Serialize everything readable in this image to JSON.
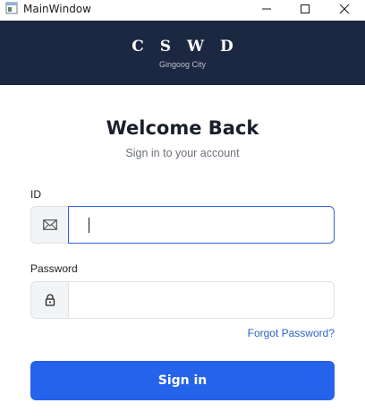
{
  "window": {
    "title": "MainWindow"
  },
  "header": {
    "title": "C S W D",
    "subtitle": "Gingoog City",
    "background": "#1c2841"
  },
  "login": {
    "heading": "Welcome Back",
    "subheading": "Sign in to your account",
    "id_label": "ID",
    "id_value": "",
    "password_label": "Password",
    "password_value": "",
    "forgot_label": "Forgot Password?",
    "signin_label": "Sign in",
    "accent": "#2563eb"
  },
  "icons": {
    "id_prefix": "envelope-icon",
    "password_prefix": "lock-icon"
  }
}
